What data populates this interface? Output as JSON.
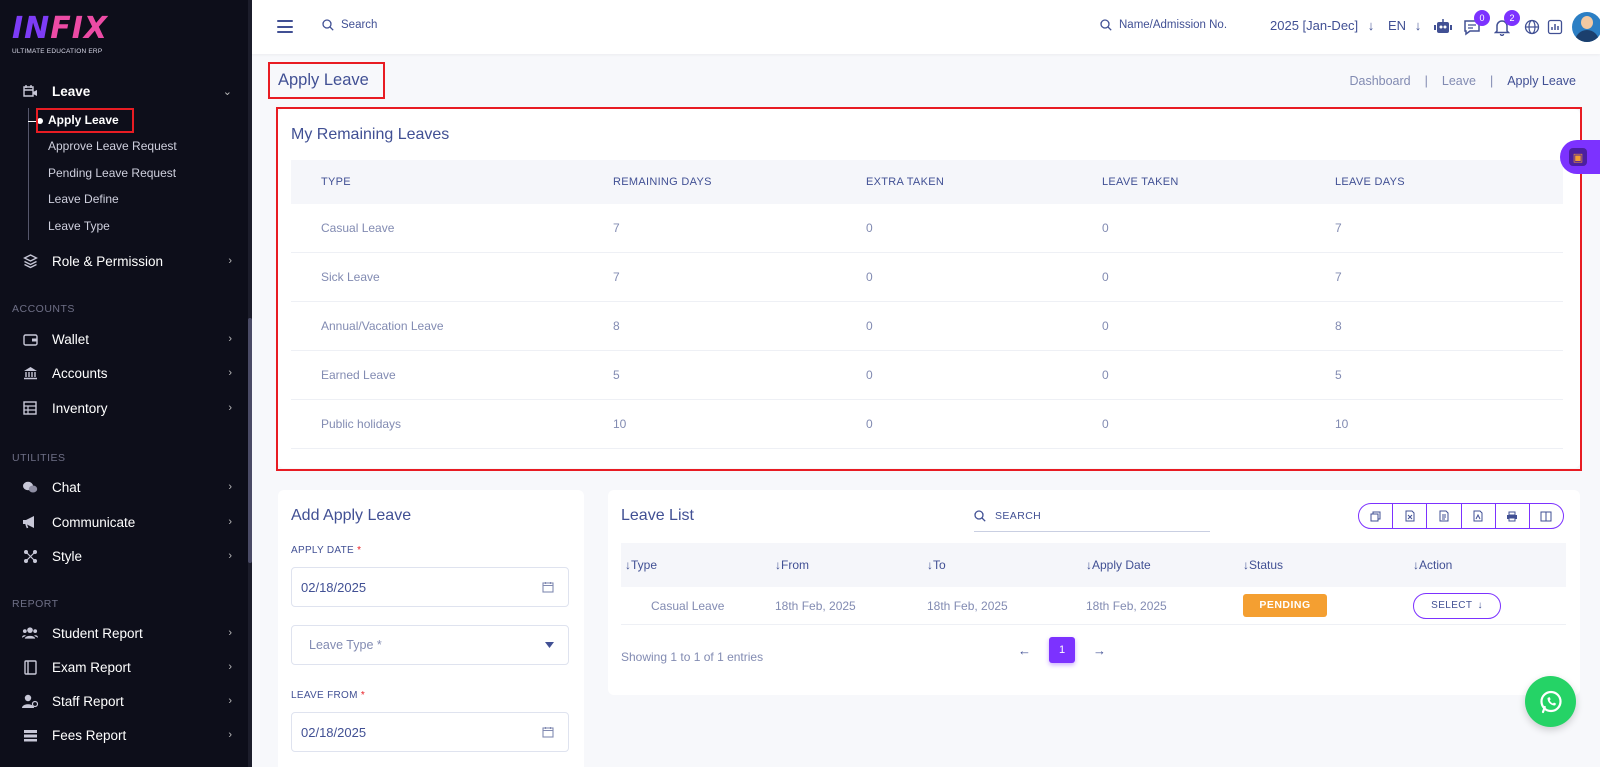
{
  "brand": {
    "name_part1": "IN",
    "name_part2": "FIX",
    "tagline": "ULTIMATE EDUCATION ERP"
  },
  "sidebar": {
    "leave_menu": {
      "label": "Leave"
    },
    "leave_subitems": [
      {
        "label": "Apply Leave",
        "active": true
      },
      {
        "label": "Approve Leave Request"
      },
      {
        "label": "Pending Leave Request"
      },
      {
        "label": "Leave Define"
      },
      {
        "label": "Leave Type"
      }
    ],
    "role_permission": {
      "label": "Role & Permission"
    },
    "sections": {
      "accounts": "ACCOUNTS",
      "utilities": "UTILITIES",
      "report": "REPORT"
    },
    "accounts_items": [
      {
        "label": "Wallet",
        "icon": "wallet-icon"
      },
      {
        "label": "Accounts",
        "icon": "bank-icon"
      },
      {
        "label": "Inventory",
        "icon": "inventory-icon"
      }
    ],
    "utilities_items": [
      {
        "label": "Chat",
        "icon": "chat-icon"
      },
      {
        "label": "Communicate",
        "icon": "megaphone-icon"
      },
      {
        "label": "Style",
        "icon": "style-icon"
      }
    ],
    "report_items": [
      {
        "label": "Student Report",
        "icon": "students-icon"
      },
      {
        "label": "Exam Report",
        "icon": "exam-icon"
      },
      {
        "label": "Staff Report",
        "icon": "staff-icon"
      },
      {
        "label": "Fees Report",
        "icon": "fees-icon"
      }
    ]
  },
  "topbar": {
    "search_placeholder": "Search",
    "name_search_placeholder": "Name/Admission No.",
    "year": "2025 [Jan-Dec]",
    "language": "EN",
    "chat_badge": "0",
    "notification_badge": "2"
  },
  "page": {
    "title": "Apply Leave",
    "breadcrumb": [
      "Dashboard",
      "Leave",
      "Apply Leave"
    ],
    "breadcrumb_sep": "|"
  },
  "remaining": {
    "title": "My Remaining Leaves",
    "columns": [
      "TYPE",
      "REMAINING DAYS",
      "EXTRA TAKEN",
      "LEAVE TAKEN",
      "LEAVE DAYS"
    ],
    "rows": [
      [
        "Casual Leave",
        "7",
        "0",
        "0",
        "7"
      ],
      [
        "Sick Leave",
        "7",
        "0",
        "0",
        "7"
      ],
      [
        "Annual/Vacation Leave",
        "8",
        "0",
        "0",
        "8"
      ],
      [
        "Earned Leave",
        "5",
        "0",
        "0",
        "5"
      ],
      [
        "Public holidays",
        "10",
        "0",
        "0",
        "10"
      ]
    ]
  },
  "add_form": {
    "title": "Add Apply Leave",
    "apply_date_label": "APPLY DATE",
    "apply_date_value": "02/18/2025",
    "leave_type_placeholder": "Leave Type *",
    "leave_from_label": "LEAVE FROM",
    "leave_from_value": "02/18/2025",
    "required_mark": "*"
  },
  "leave_list": {
    "title": "Leave List",
    "search_placeholder": "SEARCH",
    "columns": [
      "Type",
      "From",
      "To",
      "Apply Date",
      "Status",
      "Action"
    ],
    "rows": [
      {
        "type": "Casual Leave",
        "from": "18th Feb, 2025",
        "to": "18th Feb, 2025",
        "apply_date": "18th Feb, 2025",
        "status": "PENDING",
        "action": "SELECT"
      }
    ],
    "showing": "Showing 1 to 1 of 1 entries",
    "current_page": "1"
  },
  "colors": {
    "accent": "#7c32ff",
    "text": "#415094",
    "muted": "#828bb2",
    "pending": "#f49f31",
    "highlight": "#e81c23",
    "whatsapp": "#25d366"
  }
}
